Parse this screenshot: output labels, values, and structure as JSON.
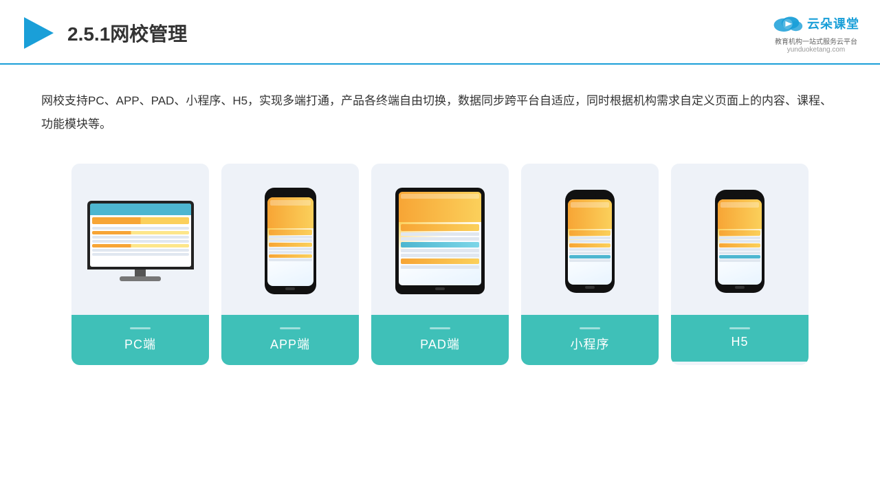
{
  "header": {
    "title": "2.5.1网校管理",
    "logo_main": "云朵课堂",
    "logo_sub": "教育机构一站\n式服务云平台",
    "logo_domain": "yunduoketang.com"
  },
  "description": {
    "text": "网校支持PC、APP、PAD、小程序、H5，实现多端打通，产品各终端自由切换，数据同步跨平台自适应，同时根据机构需求自定义页面上的内容、课程、功能模块等。"
  },
  "cards": [
    {
      "id": "pc",
      "label": "PC端"
    },
    {
      "id": "app",
      "label": "APP端"
    },
    {
      "id": "pad",
      "label": "PAD端"
    },
    {
      "id": "miniapp",
      "label": "小程序"
    },
    {
      "id": "h5",
      "label": "H5"
    }
  ]
}
